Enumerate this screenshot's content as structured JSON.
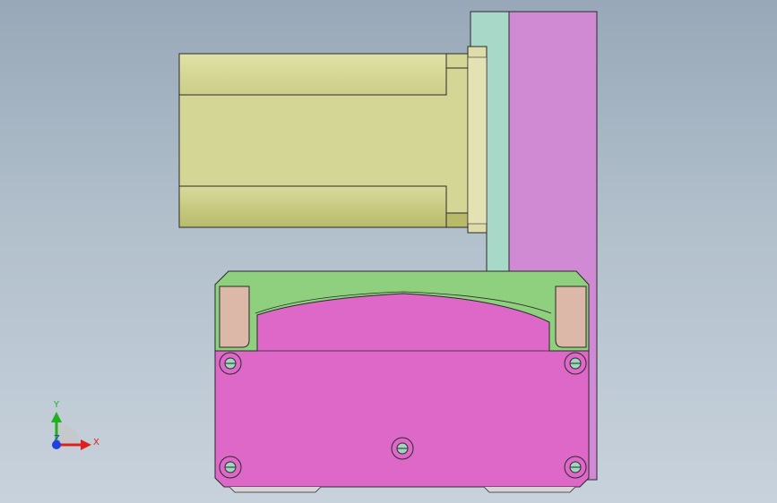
{
  "triad": {
    "x_label": "X",
    "y_label": "Y",
    "z_label": "Z",
    "x_color": "#e02020",
    "y_color": "#20b020",
    "z_color": "#2040e0"
  },
  "colors": {
    "background_top": "#98a8b8",
    "background_bottom": "#c8d2dc",
    "motor_body": "#d4d696",
    "motor_shade": "#b4b666",
    "flange": "#dedcaa",
    "plate_teal": "#a8d8c8",
    "plate_violet": "#d08ad4",
    "cover_green": "#8ed07e",
    "housing_magenta": "#de68c8",
    "block_pink": "#dcb8a8",
    "screw_teal": "#9ed6c0",
    "edge": "#2a2a2a"
  }
}
